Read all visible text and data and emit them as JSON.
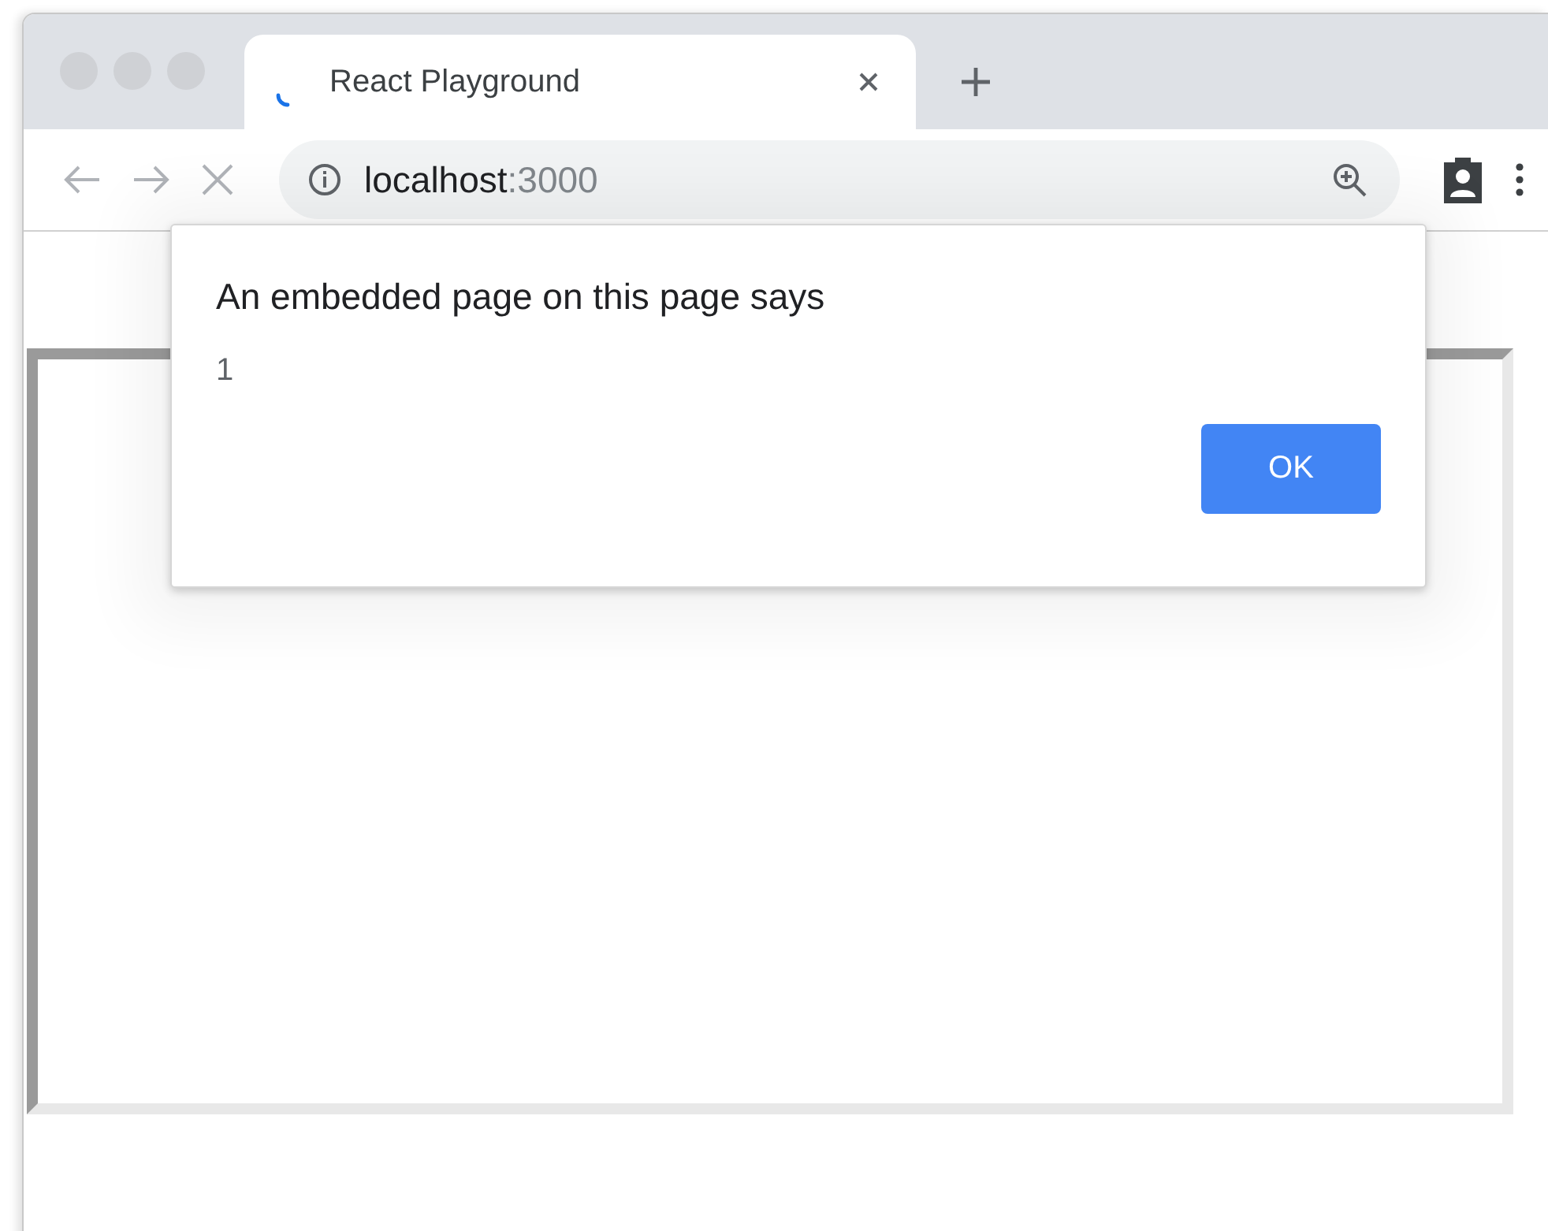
{
  "tabs": [
    {
      "title": "React Playground",
      "selected": true
    }
  ],
  "address": {
    "host": "localhost",
    "port": ":3000"
  },
  "dialog": {
    "title": "An embedded page on this page says",
    "message": "1",
    "buttons": [
      "OK"
    ]
  }
}
